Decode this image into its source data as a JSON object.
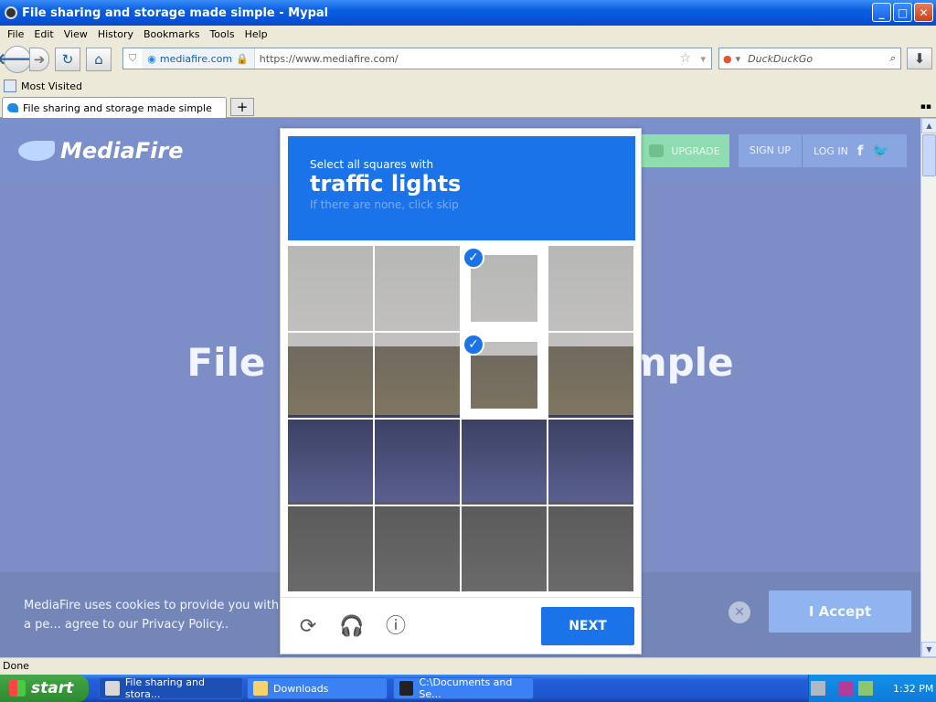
{
  "window": {
    "title": "File sharing and storage made simple - Mypal",
    "min": "_",
    "max": "□",
    "close": "✕"
  },
  "menu": [
    "File",
    "Edit",
    "View",
    "History",
    "Bookmarks",
    "Tools",
    "Help"
  ],
  "nav": {
    "site_label": "mediafire.com",
    "url": "https://www.mediafire.com/",
    "search_placeholder": "DuckDuckGo"
  },
  "bookmarks": {
    "most_visited": "Most Visited"
  },
  "tab": {
    "title": "File sharing and storage made simple",
    "new_tab": "+"
  },
  "site": {
    "logo_text": "MediaFire",
    "upgrade": "UPGRADE",
    "signup": "SIGN UP",
    "login": "LOG IN",
    "facebook": "f",
    "twitter": "🐦",
    "hero": "File storage made simple",
    "cookie_text": "MediaFire uses cookies to provide you with a pe... agree to our Privacy Policy..",
    "cookie_close": "✕",
    "accept": "I Accept"
  },
  "captcha": {
    "line1": "Select all squares with",
    "line2": "traffic lights",
    "line3": "If there are none, click skip",
    "next": "NEXT",
    "selected": [
      2,
      6
    ],
    "reload_icon": "⟳",
    "audio_icon": "🎧",
    "info_icon": "ⓘ"
  },
  "status": "Done",
  "taskbar": {
    "start": "start",
    "tasks": [
      "File sharing and stora...",
      "Downloads",
      "C:\\Documents and Se..."
    ],
    "clock": "1:32 PM"
  },
  "colors": {
    "captcha_blue": "#1a73e8",
    "page_overlay": "#7c8ec5"
  }
}
